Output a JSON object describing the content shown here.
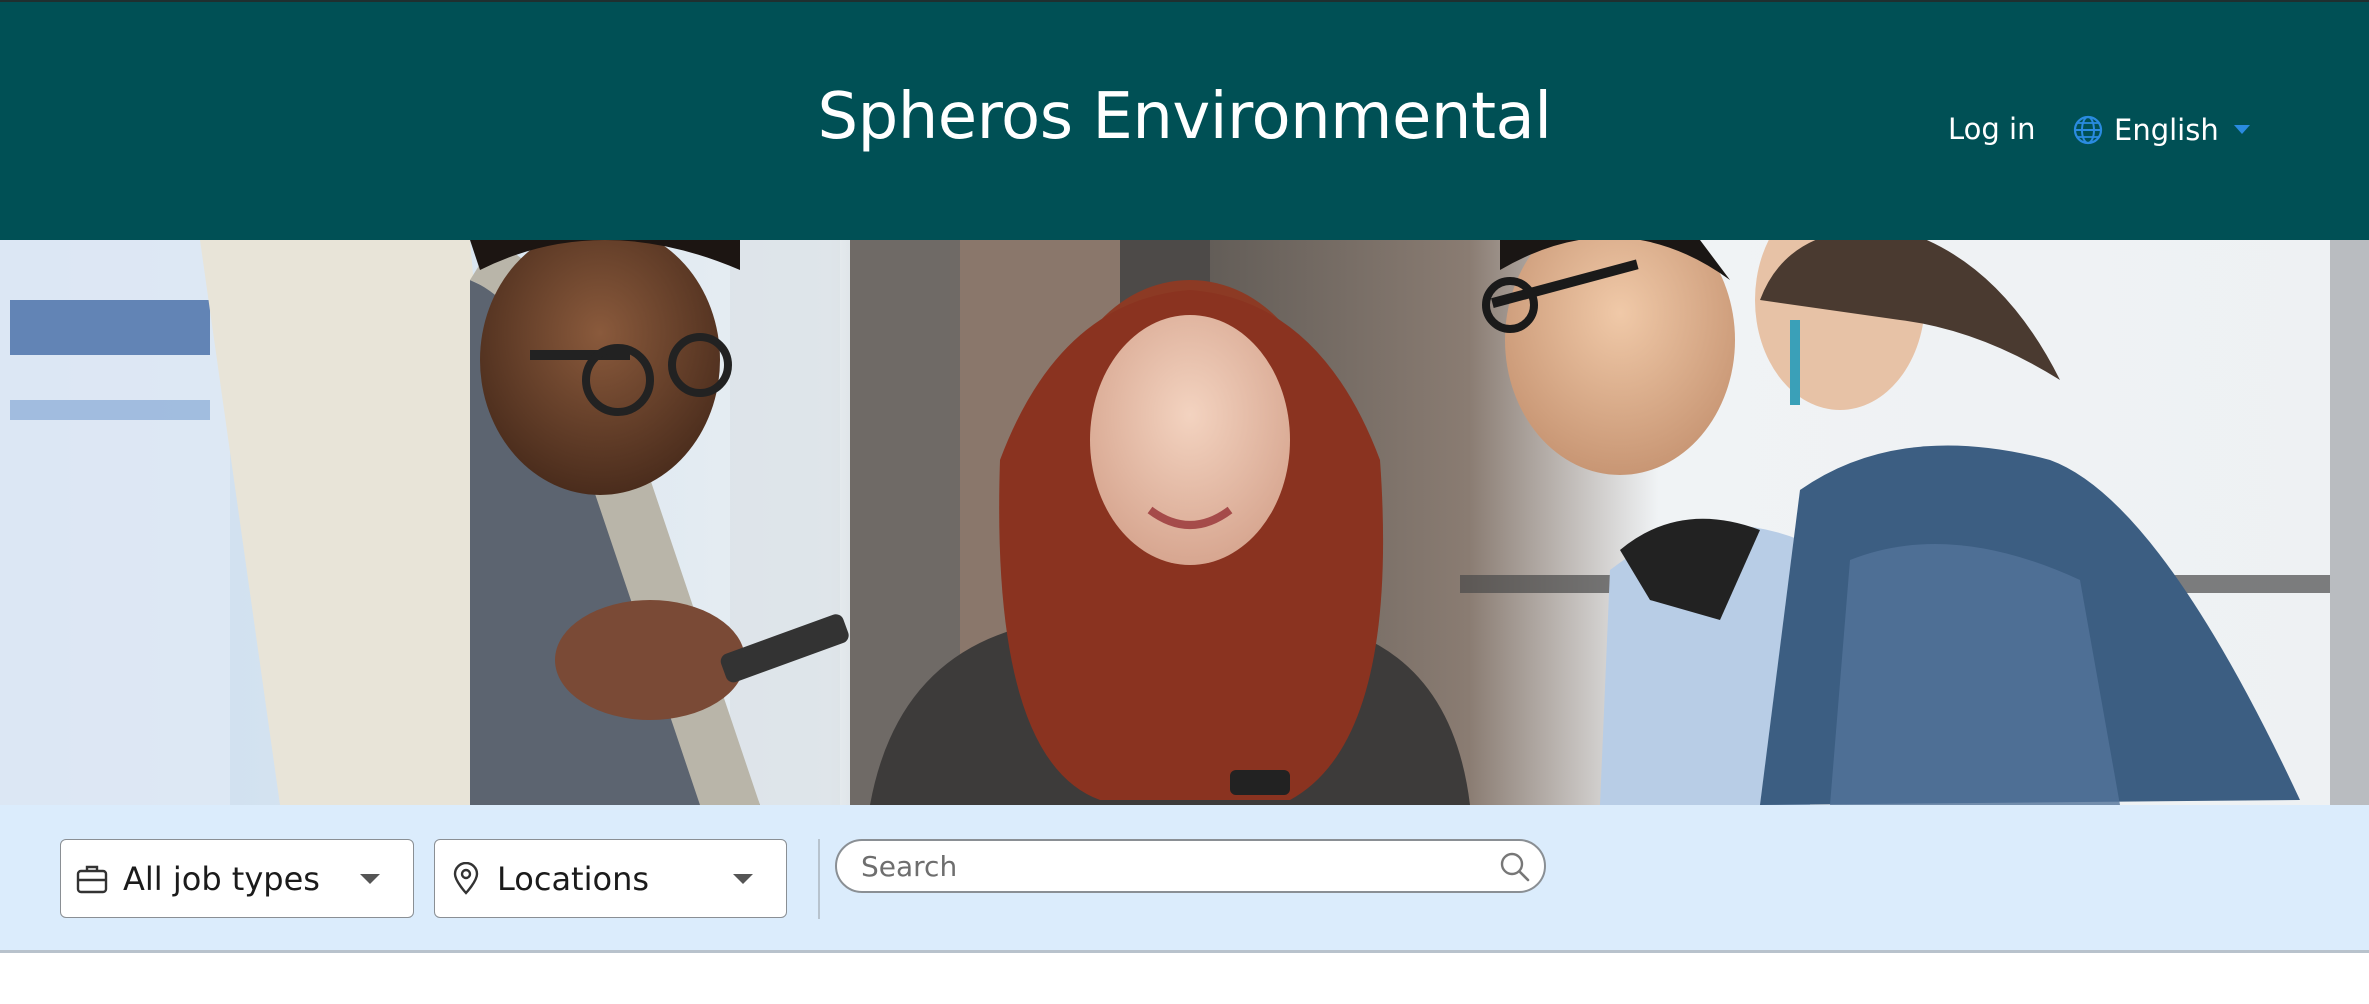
{
  "header": {
    "title": "Spheros Environmental",
    "login_label": "Log in",
    "language": "English"
  },
  "hero": {
    "image": "people-looking-at-phones"
  },
  "filters": {
    "job_types_label": "All job types",
    "locations_label": "Locations",
    "search_placeholder": "Search"
  },
  "icons": {
    "globe": "globe-icon",
    "briefcase": "briefcase-icon",
    "location": "map-pin-icon",
    "search": "search-icon",
    "caret": "chevron-down-icon"
  },
  "colors": {
    "header_bg": "#005055",
    "accent_blue": "#2a8be0",
    "filter_bar_bg": "#dbecfc"
  }
}
